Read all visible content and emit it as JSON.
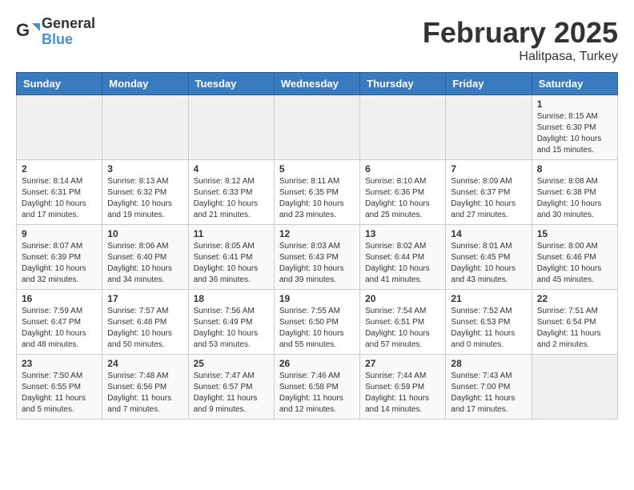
{
  "header": {
    "logo_general": "General",
    "logo_blue": "Blue",
    "month": "February 2025",
    "location": "Halitpasa, Turkey"
  },
  "weekdays": [
    "Sunday",
    "Monday",
    "Tuesday",
    "Wednesday",
    "Thursday",
    "Friday",
    "Saturday"
  ],
  "rows": [
    [
      {
        "day": "",
        "info": ""
      },
      {
        "day": "",
        "info": ""
      },
      {
        "day": "",
        "info": ""
      },
      {
        "day": "",
        "info": ""
      },
      {
        "day": "",
        "info": ""
      },
      {
        "day": "",
        "info": ""
      },
      {
        "day": "1",
        "info": "Sunrise: 8:15 AM\nSunset: 6:30 PM\nDaylight: 10 hours\nand 15 minutes."
      }
    ],
    [
      {
        "day": "2",
        "info": "Sunrise: 8:14 AM\nSunset: 6:31 PM\nDaylight: 10 hours\nand 17 minutes."
      },
      {
        "day": "3",
        "info": "Sunrise: 8:13 AM\nSunset: 6:32 PM\nDaylight: 10 hours\nand 19 minutes."
      },
      {
        "day": "4",
        "info": "Sunrise: 8:12 AM\nSunset: 6:33 PM\nDaylight: 10 hours\nand 21 minutes."
      },
      {
        "day": "5",
        "info": "Sunrise: 8:11 AM\nSunset: 6:35 PM\nDaylight: 10 hours\nand 23 minutes."
      },
      {
        "day": "6",
        "info": "Sunrise: 8:10 AM\nSunset: 6:36 PM\nDaylight: 10 hours\nand 25 minutes."
      },
      {
        "day": "7",
        "info": "Sunrise: 8:09 AM\nSunset: 6:37 PM\nDaylight: 10 hours\nand 27 minutes."
      },
      {
        "day": "8",
        "info": "Sunrise: 8:08 AM\nSunset: 6:38 PM\nDaylight: 10 hours\nand 30 minutes."
      }
    ],
    [
      {
        "day": "9",
        "info": "Sunrise: 8:07 AM\nSunset: 6:39 PM\nDaylight: 10 hours\nand 32 minutes."
      },
      {
        "day": "10",
        "info": "Sunrise: 8:06 AM\nSunset: 6:40 PM\nDaylight: 10 hours\nand 34 minutes."
      },
      {
        "day": "11",
        "info": "Sunrise: 8:05 AM\nSunset: 6:41 PM\nDaylight: 10 hours\nand 36 minutes."
      },
      {
        "day": "12",
        "info": "Sunrise: 8:03 AM\nSunset: 6:43 PM\nDaylight: 10 hours\nand 39 minutes."
      },
      {
        "day": "13",
        "info": "Sunrise: 8:02 AM\nSunset: 6:44 PM\nDaylight: 10 hours\nand 41 minutes."
      },
      {
        "day": "14",
        "info": "Sunrise: 8:01 AM\nSunset: 6:45 PM\nDaylight: 10 hours\nand 43 minutes."
      },
      {
        "day": "15",
        "info": "Sunrise: 8:00 AM\nSunset: 6:46 PM\nDaylight: 10 hours\nand 45 minutes."
      }
    ],
    [
      {
        "day": "16",
        "info": "Sunrise: 7:59 AM\nSunset: 6:47 PM\nDaylight: 10 hours\nand 48 minutes."
      },
      {
        "day": "17",
        "info": "Sunrise: 7:57 AM\nSunset: 6:48 PM\nDaylight: 10 hours\nand 50 minutes."
      },
      {
        "day": "18",
        "info": "Sunrise: 7:56 AM\nSunset: 6:49 PM\nDaylight: 10 hours\nand 53 minutes."
      },
      {
        "day": "19",
        "info": "Sunrise: 7:55 AM\nSunset: 6:50 PM\nDaylight: 10 hours\nand 55 minutes."
      },
      {
        "day": "20",
        "info": "Sunrise: 7:54 AM\nSunset: 6:51 PM\nDaylight: 10 hours\nand 57 minutes."
      },
      {
        "day": "21",
        "info": "Sunrise: 7:52 AM\nSunset: 6:53 PM\nDaylight: 11 hours\nand 0 minutes."
      },
      {
        "day": "22",
        "info": "Sunrise: 7:51 AM\nSunset: 6:54 PM\nDaylight: 11 hours\nand 2 minutes."
      }
    ],
    [
      {
        "day": "23",
        "info": "Sunrise: 7:50 AM\nSunset: 6:55 PM\nDaylight: 11 hours\nand 5 minutes."
      },
      {
        "day": "24",
        "info": "Sunrise: 7:48 AM\nSunset: 6:56 PM\nDaylight: 11 hours\nand 7 minutes."
      },
      {
        "day": "25",
        "info": "Sunrise: 7:47 AM\nSunset: 6:57 PM\nDaylight: 11 hours\nand 9 minutes."
      },
      {
        "day": "26",
        "info": "Sunrise: 7:46 AM\nSunset: 6:58 PM\nDaylight: 11 hours\nand 12 minutes."
      },
      {
        "day": "27",
        "info": "Sunrise: 7:44 AM\nSunset: 6:59 PM\nDaylight: 11 hours\nand 14 minutes."
      },
      {
        "day": "28",
        "info": "Sunrise: 7:43 AM\nSunset: 7:00 PM\nDaylight: 11 hours\nand 17 minutes."
      },
      {
        "day": "",
        "info": ""
      }
    ]
  ]
}
